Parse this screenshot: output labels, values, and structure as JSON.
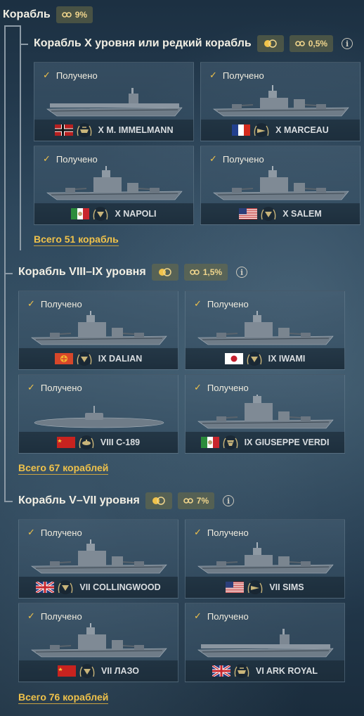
{
  "root": {
    "title": "Корабль",
    "progress": "9%"
  },
  "sections": [
    {
      "title": "Корабль X уровня или редкий корабль",
      "percent": "0,5%",
      "total": "Всего 51 корабль",
      "ships": [
        {
          "status": "Получено",
          "tier": "X",
          "name": "M. IMMELMANN",
          "label": "X M. IMMELMANN",
          "nation": "germany",
          "type": "carrier"
        },
        {
          "status": "Получено",
          "tier": "X",
          "name": "MARCEAU",
          "label": "X MARCEAU",
          "nation": "france",
          "type": "destroyer"
        },
        {
          "status": "Получено",
          "tier": "X",
          "name": "NAPOLI",
          "label": "X NAPOLI",
          "nation": "italy",
          "type": "cruiser"
        },
        {
          "status": "Получено",
          "tier": "X",
          "name": "SALEM",
          "label": "X SALEM",
          "nation": "usa",
          "type": "cruiser"
        }
      ]
    },
    {
      "title": "Корабль VIII–IX уровня",
      "percent": "1,5%",
      "total": "Всего 67 кораблей",
      "ships": [
        {
          "status": "Получено",
          "tier": "IX",
          "name": "DALIAN",
          "label": "IX DALIAN",
          "nation": "panasia",
          "type": "cruiser"
        },
        {
          "status": "Получено",
          "tier": "IX",
          "name": "IWAMI",
          "label": "IX IWAMI",
          "nation": "japan",
          "type": "cruiser"
        },
        {
          "status": "Получено",
          "tier": "VIII",
          "name": "C-189",
          "label": "VIII C-189",
          "nation": "ussr",
          "type": "submarine"
        },
        {
          "status": "Получено",
          "tier": "IX",
          "name": "GIUSEPPE VERDI",
          "label": "IX GIUSEPPE VERDI",
          "nation": "italy",
          "type": "battleship"
        }
      ]
    },
    {
      "title": "Корабль V–VII уровня",
      "percent": "7%",
      "total": "Всего 76 кораблей",
      "ships": [
        {
          "status": "Получено",
          "tier": "VII",
          "name": "COLLINGWOOD",
          "label": "VII COLLINGWOOD",
          "nation": "uk",
          "type": "cruiser"
        },
        {
          "status": "Получено",
          "tier": "VII",
          "name": "SIMS",
          "label": "VII SIMS",
          "nation": "usa",
          "type": "destroyer"
        },
        {
          "status": "Получено",
          "tier": "VII",
          "name": "ЛАЗО",
          "label": "VII ЛАЗО",
          "nation": "ussr",
          "type": "cruiser"
        },
        {
          "status": "Получено",
          "tier": "VI",
          "name": "ARK ROYAL",
          "label": "VI ARK ROYAL",
          "nation": "uk",
          "type": "carrier"
        }
      ]
    }
  ],
  "colors": {
    "accent": "#f0c24a",
    "badge_text": "#f0d58c",
    "badge_bg": "#5a5a3a"
  },
  "icons": {
    "link": "link-icon",
    "coin": "coin-toggle-icon",
    "info": "info-icon",
    "check": "check-icon"
  }
}
